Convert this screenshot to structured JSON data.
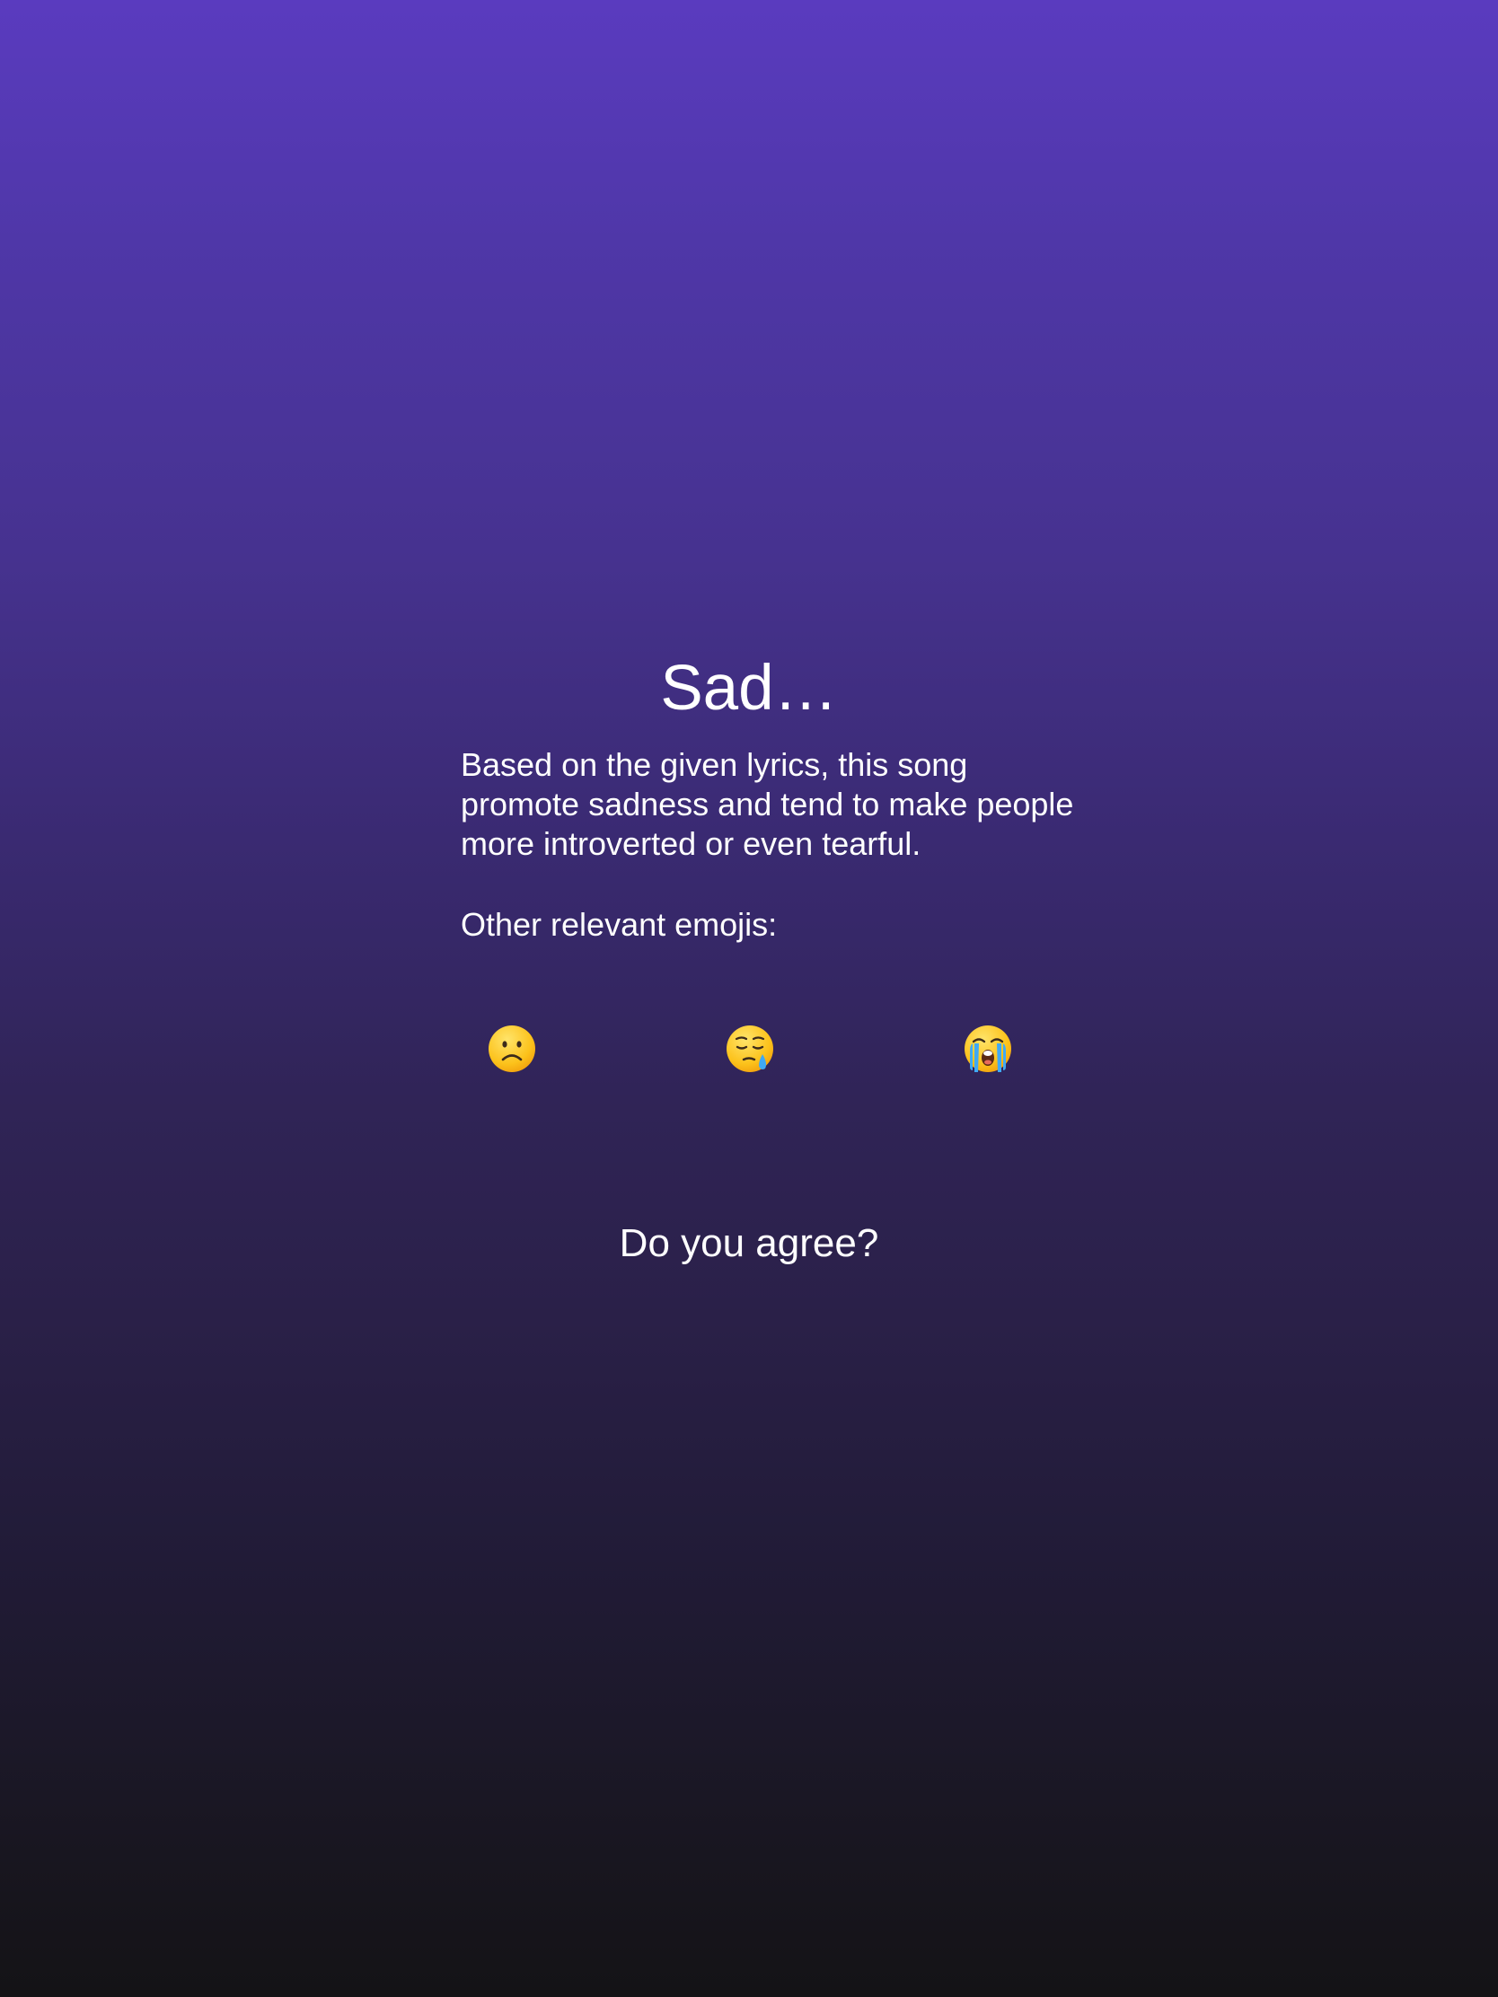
{
  "result": {
    "title": "Sad…",
    "description": "Based on the given lyrics, this song promote sadness and tend to make people more introverted or even tearful.",
    "emojis_heading": "Other relevant emojis:",
    "emojis": [
      {
        "name": "frowning-face-emoji"
      },
      {
        "name": "sleepy-face-emoji"
      },
      {
        "name": "loudly-crying-face-emoji"
      }
    ],
    "agree_prompt": "Do you agree?"
  },
  "colors": {
    "gradient_top": "#5a3bbf",
    "gradient_bottom": "#141316",
    "text": "#ffffff",
    "emoji_face": "#fcc21b"
  }
}
